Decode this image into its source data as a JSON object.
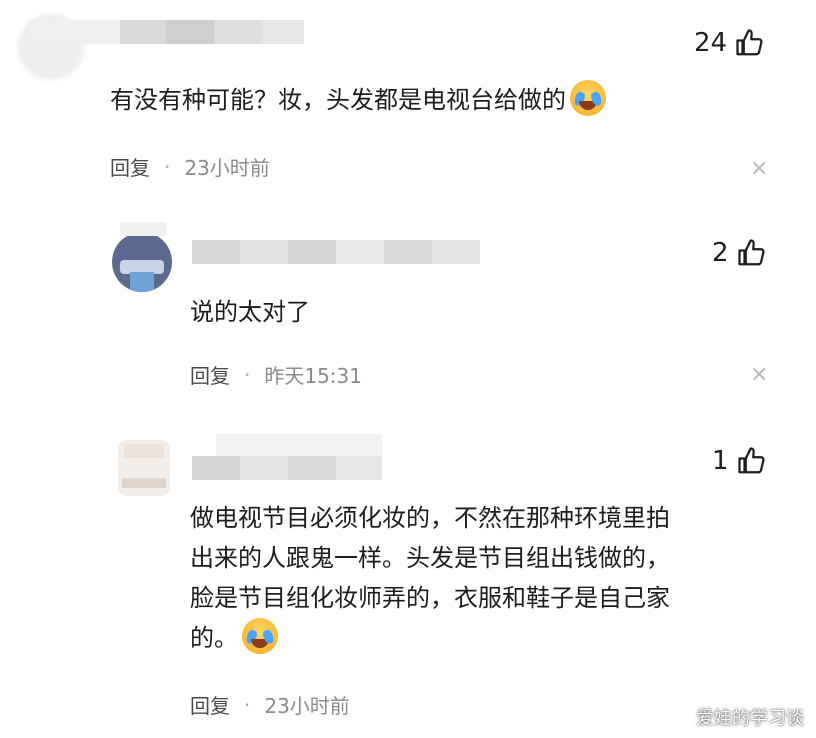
{
  "comments": [
    {
      "likes": "24",
      "text": "有没有种可能？妆，头发都是电视台给做的",
      "reply_label": "回复",
      "separator": "·",
      "time": "23小时前"
    },
    {
      "likes": "2",
      "text": "说的太对了",
      "reply_label": "回复",
      "separator": "·",
      "time": "昨天15:31"
    },
    {
      "likes": "1",
      "lines": [
        "做电视节目必须化妆的，不然在那种环境里拍",
        "出来的人跟鬼一样。头发是节目组出钱做的，",
        "脸是节目组化妆师弄的，衣服和鞋子是自己家",
        "的。"
      ],
      "reply_label": "回复",
      "separator": "·",
      "time": "23小时前"
    }
  ],
  "icons": {
    "like": "thumbs-up-icon",
    "close": "close-icon",
    "emoji": "crying-laughing-emoji"
  },
  "close_glyph": "×",
  "watermark": "爱娃的学习谈"
}
